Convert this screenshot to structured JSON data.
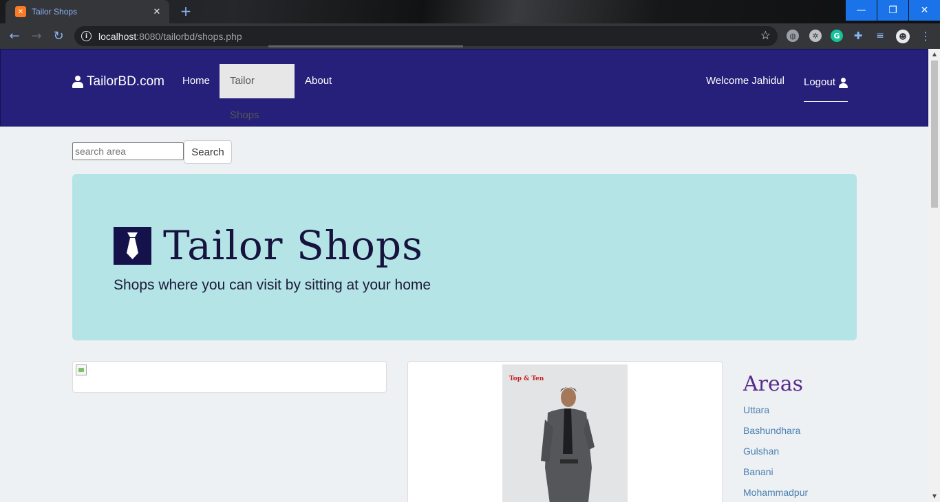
{
  "browser": {
    "tab_title": "Tailor Shops",
    "url_host": "localhost",
    "url_rest": ":8080/tailorbd/shops.php",
    "window_controls": [
      "—",
      "❐",
      "✕"
    ]
  },
  "nav": {
    "brand": "TailorBD.com",
    "links": [
      "Home",
      "Tailor Shops",
      "About"
    ],
    "active": "Tailor Shops",
    "welcome": "Welcome Jahidul",
    "logout": "Logout"
  },
  "search": {
    "placeholder": "search area",
    "button": "Search"
  },
  "jumbotron": {
    "title": "Tailor Shops",
    "subtitle": "Shops where you can visit by sitting at your home"
  },
  "shop_photo_logo": "Top & Ten",
  "areas": {
    "title": "Areas",
    "items": [
      "Uttara",
      "Bashundhara",
      "Gulshan",
      "Banani",
      "Mohammadpur"
    ]
  },
  "colors": {
    "navbar": "#27207a",
    "jumbotron": "#b5e4e6",
    "page_bg": "#edf1f4",
    "areas_title": "#5a2a8a",
    "area_link": "#4a7fb0"
  }
}
